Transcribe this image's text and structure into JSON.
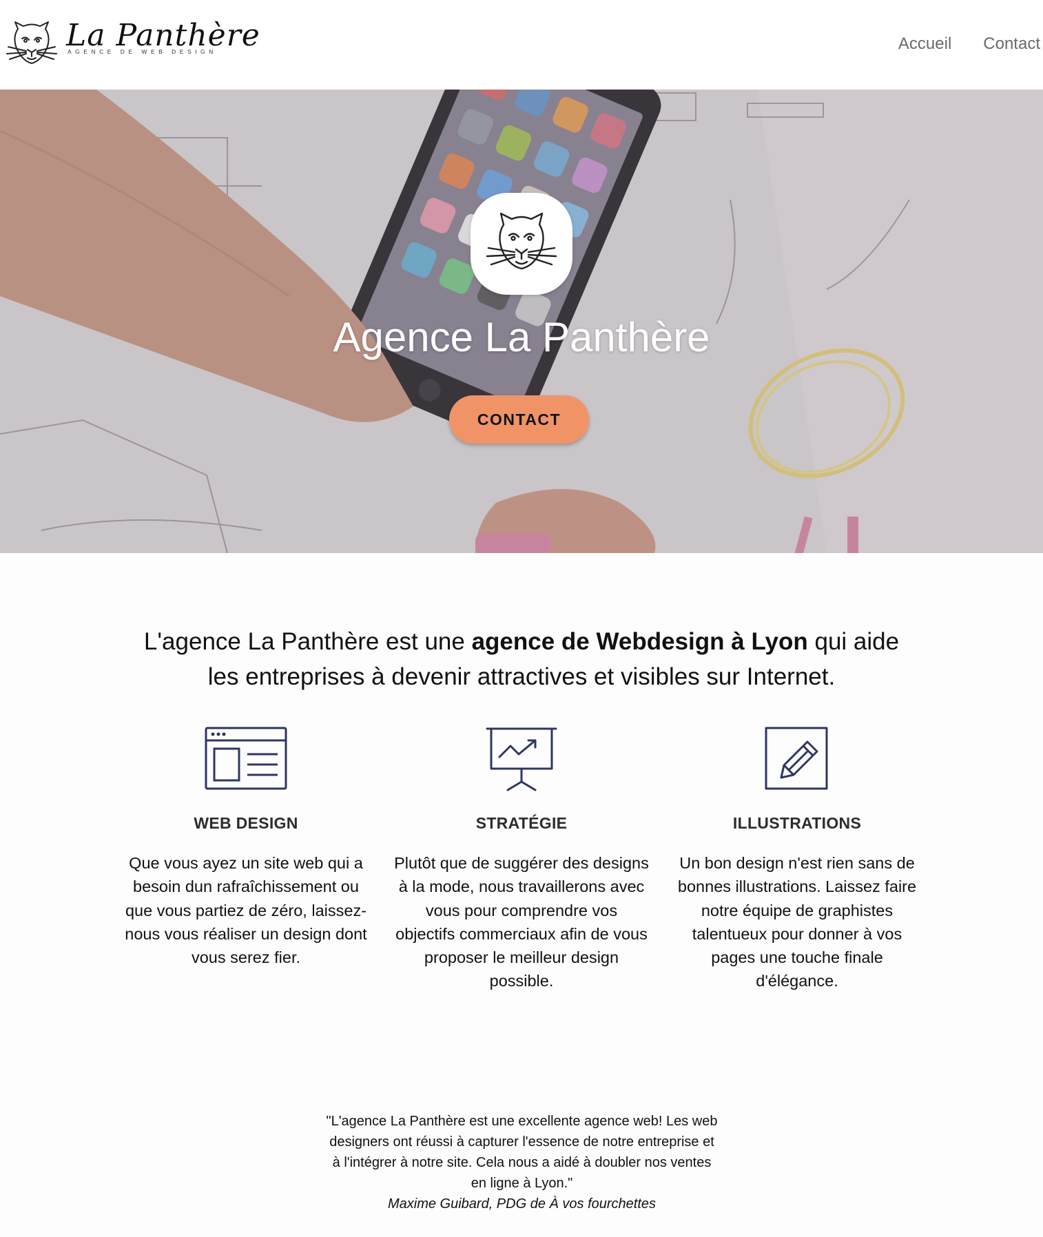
{
  "header": {
    "brand_name": "La Panthère",
    "brand_tagline": "AGENCE DE WEB DESIGN",
    "logo_icon": "panther-head-icon",
    "nav": [
      {
        "label": "Accueil"
      },
      {
        "label": "Contact"
      }
    ]
  },
  "hero": {
    "title": "Agence La Panthère",
    "cta_label": "CONTACT",
    "logo_icon": "panther-head-icon",
    "background": "hand-sketching-wireframes-photo",
    "accent_color": "#f09468"
  },
  "intro": {
    "part1": "L'agence La Panthère est une ",
    "emphasis": "agence de Webdesign à Lyon",
    "part2": " qui aide les entreprises à devenir attractives et visibles sur Internet."
  },
  "features": [
    {
      "icon": "browser-layout-icon",
      "title": "WEB DESIGN",
      "text": "Que vous ayez un site web qui a besoin dun rafraîchissement ou que vous partiez de zéro, laissez-nous vous réaliser un design dont vous serez fier."
    },
    {
      "icon": "presentation-chart-icon",
      "title": "STRATÉGIE",
      "text": "Plutôt que de suggérer des designs à la mode, nous travaillerons avec vous pour comprendre vos objectifs commerciaux afin de vous proposer le meilleur design possible."
    },
    {
      "icon": "pencil-square-icon",
      "title": "ILLUSTRATIONS",
      "text": "Un bon design n'est rien sans de bonnes illustrations. Laissez faire notre équipe de graphistes talentueux pour donner à vos pages une touche finale d'élégance."
    }
  ],
  "testimonial": {
    "quote": "\"L'agence La Panthère est une excellente agence web! Les web designers ont réussi à capturer l'essence de notre entreprise et à l'intégrer à notre site. Cela nous a aidé à doubler nos ventes en ligne à Lyon.\"",
    "author": "Maxime Guibard, PDG de À vos fourchettes"
  },
  "colors": {
    "icon_stroke": "#2e3566",
    "nav_text": "#6a6a6a",
    "cta": "#f09468"
  }
}
